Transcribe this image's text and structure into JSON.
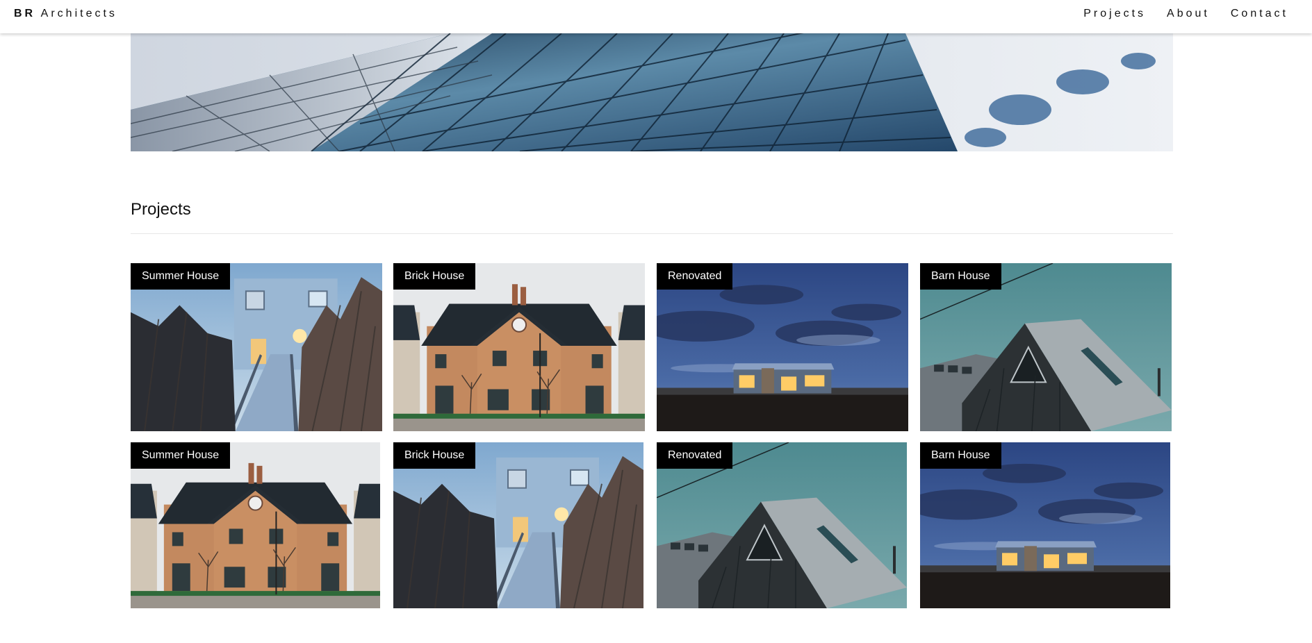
{
  "header": {
    "brand_bold": "BR",
    "brand_rest": "Architects",
    "nav": [
      "Projects",
      "About",
      "Contact"
    ]
  },
  "projects": {
    "title": "Projects",
    "cards": [
      {
        "label": "Summer House",
        "scene": "walkway"
      },
      {
        "label": "Brick House",
        "scene": "brick"
      },
      {
        "label": "Renovated",
        "scene": "dusk"
      },
      {
        "label": "Barn House",
        "scene": "barn"
      },
      {
        "label": "Summer House",
        "scene": "brick"
      },
      {
        "label": "Brick House",
        "scene": "walkway"
      },
      {
        "label": "Renovated",
        "scene": "barn"
      },
      {
        "label": "Barn House",
        "scene": "dusk"
      }
    ]
  }
}
